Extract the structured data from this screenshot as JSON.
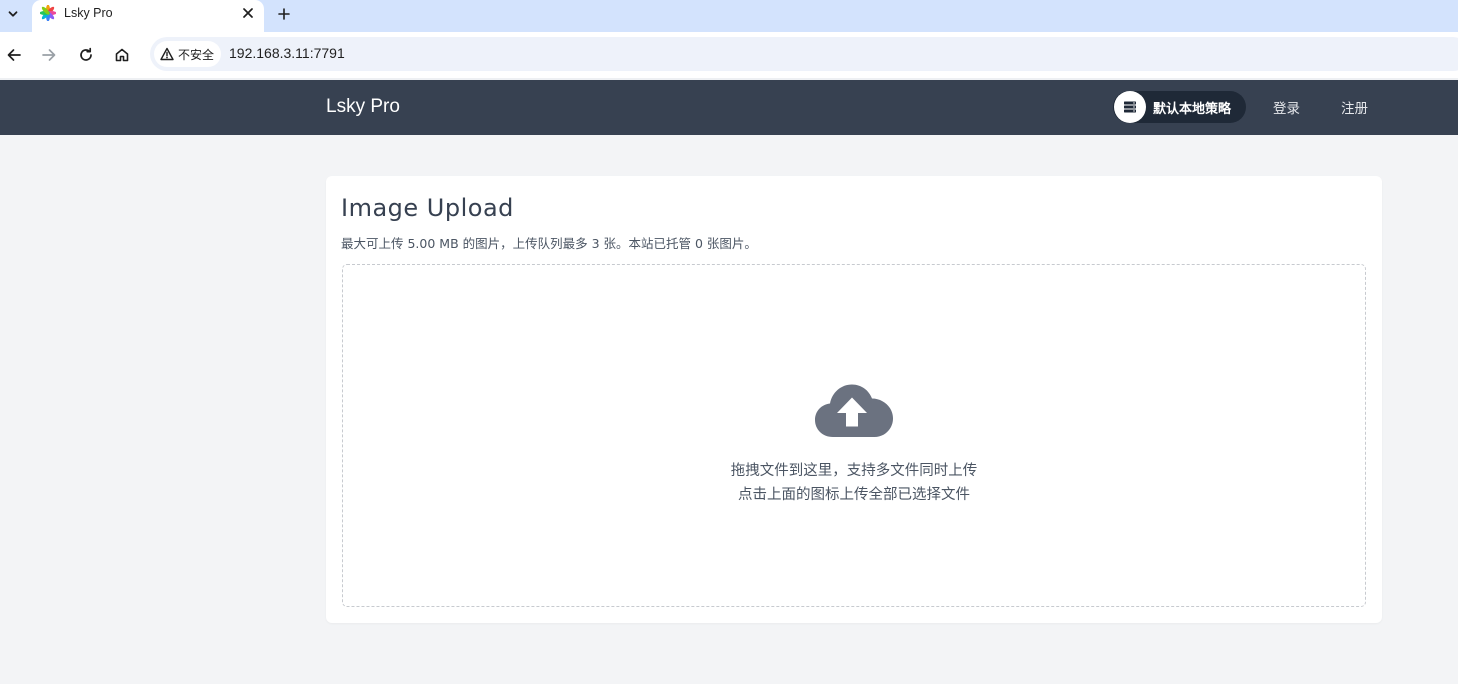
{
  "browser": {
    "tab": {
      "title": "Lsky Pro",
      "favicon": "lsky-flower-icon"
    },
    "security_label": "不安全",
    "url": "192.168.3.11:7791"
  },
  "nav": {
    "brand": "Lsky Pro",
    "strategy_label": "默认本地策略",
    "login": "登录",
    "register": "注册"
  },
  "upload": {
    "title": "Image Upload",
    "description": "最大可上传 5.00 MB 的图片，上传队列最多 3 张。本站已托管 0 张图片。",
    "drop_line1": "拖拽文件到这里，支持多文件同时上传",
    "drop_line2": "点击上面的图标上传全部已选择文件"
  },
  "colors": {
    "nav_bg": "#374151",
    "page_bg": "#f3f4f6",
    "icon_gray": "#6b7280",
    "tabstrip_bg": "#d3e3fd"
  }
}
